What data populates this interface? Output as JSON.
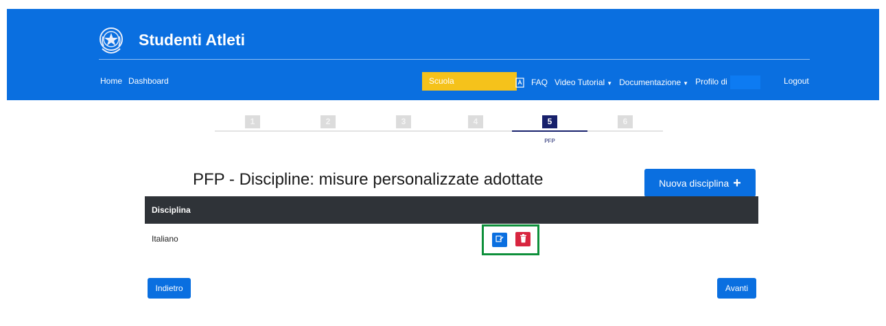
{
  "header": {
    "brand": "Studenti Atleti",
    "emblem_icon": "italian-republic-emblem-icon",
    "bg_color": "#0a6fe0"
  },
  "nav": {
    "home": "Home",
    "dashboard": "Dashboard",
    "school": "Scuola",
    "faq": "FAQ",
    "video_tutorial": "Video Tutorial",
    "documentazione": "Documentazione",
    "profilo": "Profilo di",
    "logout": "Logout"
  },
  "steps": [
    {
      "num": "1",
      "label": "",
      "active": false
    },
    {
      "num": "2",
      "label": "",
      "active": false
    },
    {
      "num": "3",
      "label": "",
      "active": false
    },
    {
      "num": "4",
      "label": "",
      "active": false
    },
    {
      "num": "5",
      "label": "PFP",
      "active": true
    },
    {
      "num": "6",
      "label": "",
      "active": false
    }
  ],
  "page": {
    "title": "PFP - Discipline: misure personalizzate adottate",
    "new_button": "Nuova disciplina"
  },
  "table": {
    "headers": [
      "Disciplina"
    ],
    "rows": [
      {
        "disciplina": "Italiano"
      }
    ]
  },
  "footer": {
    "back": "Indietro",
    "next": "Avanti"
  },
  "colors": {
    "primary": "#0a6fe0",
    "school": "#f5c21b",
    "danger": "#d8253f",
    "active_step": "#17206b",
    "highlight": "#0d8f3a"
  }
}
